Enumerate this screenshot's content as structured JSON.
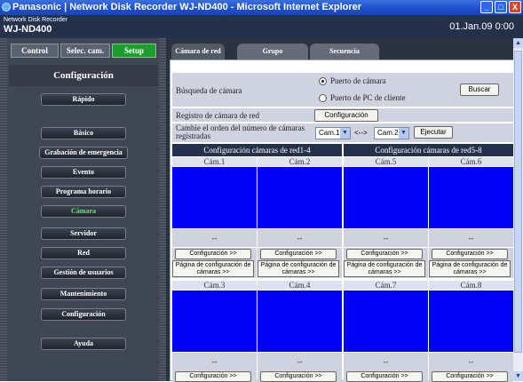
{
  "window": {
    "title": "Panasonic | Network Disk Recorder WJ-ND400 - Microsoft Internet Explorer",
    "minimize": "_",
    "maximize": "□",
    "close": "X"
  },
  "header": {
    "sub": "Network Disk Recorder",
    "model": "WJ-ND400",
    "datetime": "01.Jan.09  0:00"
  },
  "sidebar": {
    "tabs": [
      {
        "label": "Control"
      },
      {
        "label": "Selec. cam."
      },
      {
        "label": "Setup"
      }
    ],
    "section": "Configuración",
    "items": [
      {
        "label": "Rápido"
      },
      {
        "label": "Básico"
      },
      {
        "label": "Grabación de emergencia"
      },
      {
        "label": "Evento"
      },
      {
        "label": "Programa horario"
      },
      {
        "label": "Cámara"
      },
      {
        "label": "Servidor"
      },
      {
        "label": "Red"
      },
      {
        "label": "Gestión de usuarios"
      },
      {
        "label": "Mantenimiento"
      },
      {
        "label": "Configuración"
      },
      {
        "label": "Ayuda"
      }
    ]
  },
  "content": {
    "tabs": [
      {
        "label": "Cámara de red"
      },
      {
        "label": "Grupo"
      },
      {
        "label": "Secuencia"
      }
    ],
    "search": {
      "label": "Búsqueda de cámara",
      "option1": "Puerto de cámara",
      "option2": "Puerto de PC de cliente",
      "selected": "Puerto de cámara",
      "button": "Buscar"
    },
    "register": {
      "label": "Registro de cámara de red",
      "button": "Configuración"
    },
    "order": {
      "label": "Cambie el orden del número de cámaras registradas",
      "from": "Cam.1",
      "swap": "<-->",
      "to": "Cam.2",
      "button": "Ejecutar"
    },
    "groups": [
      {
        "label": "Configuración cámaras de red1-4"
      },
      {
        "label": "Configuración cámaras de red5-8"
      }
    ],
    "cameras": [
      {
        "label": "Cám.1"
      },
      {
        "label": "Cám.2"
      },
      {
        "label": "Cám.5"
      },
      {
        "label": "Cám.6"
      },
      {
        "label": "Cám.3"
      },
      {
        "label": "Cám.4"
      },
      {
        "label": "Cám.7"
      },
      {
        "label": "Cám.8"
      }
    ],
    "dash": "--",
    "config_button": "Configuración >>",
    "page_button": "Página de configuración de cámaras >>"
  },
  "colors": {
    "header": "#25304a",
    "sidebar": "#3f4654",
    "active_tab": "#1c9e2c",
    "camera_view": "#0000f4",
    "selected_item_text": "#5cf06a"
  }
}
